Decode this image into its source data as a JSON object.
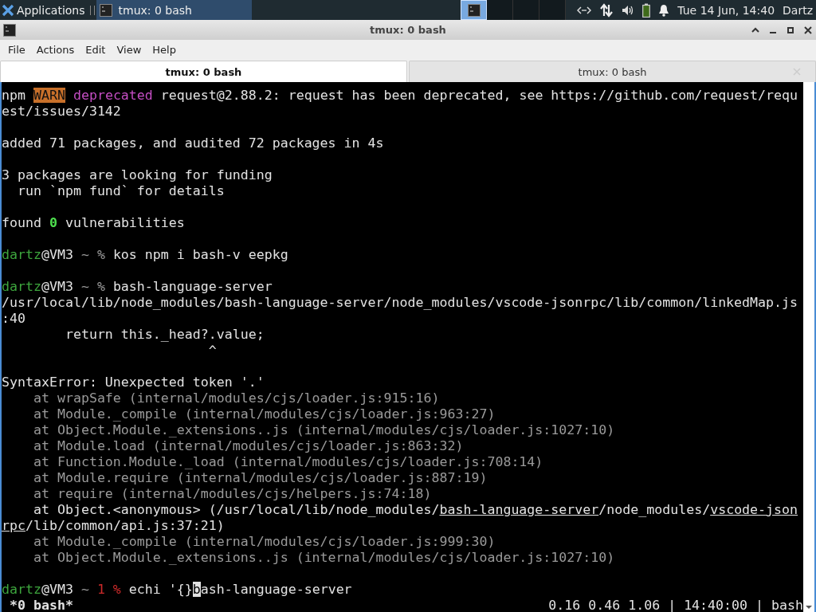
{
  "taskbar": {
    "applications_label": "Applications",
    "tasks": [
      {
        "label": "tmux: 0 bash",
        "selected": true
      }
    ],
    "workspaces": [
      {
        "selected": true
      },
      {
        "selected": false
      },
      {
        "selected": false
      },
      {
        "selected": false
      }
    ],
    "clock": "Tue 14 Jun, 14:40",
    "user": "Dartz"
  },
  "window": {
    "title": "tmux: 0 bash",
    "menu": [
      "File",
      "Actions",
      "Edit",
      "View",
      "Help"
    ],
    "tabs": [
      {
        "label": "tmux: 0 bash",
        "selected": true
      },
      {
        "label": "tmux: 0 bash",
        "selected": false
      }
    ],
    "terminal": {
      "lines": [
        {
          "kind": "text",
          "segments": [
            {
              "kind": "plain",
              "text": "npm "
            },
            {
              "kind": "warn",
              "text": "WARN"
            },
            {
              "kind": "magenta",
              "text": " deprecated"
            },
            {
              "kind": "plain",
              "text": " request@2.88.2: request has been deprecated, see https://github.com/request/requ"
            }
          ]
        },
        {
          "kind": "text",
          "segments": [
            {
              "kind": "plain",
              "text": "est/issues/3142"
            }
          ]
        },
        {
          "kind": "blank"
        },
        {
          "kind": "text",
          "segments": [
            {
              "kind": "plain",
              "text": "added 71 packages, and audited 72 packages in 4s"
            }
          ]
        },
        {
          "kind": "blank"
        },
        {
          "kind": "text",
          "segments": [
            {
              "kind": "plain",
              "text": "3 packages are looking for funding"
            }
          ]
        },
        {
          "kind": "text",
          "segments": [
            {
              "kind": "plain",
              "text": "  run `npm fund` for details"
            }
          ]
        },
        {
          "kind": "blank"
        },
        {
          "kind": "text",
          "segments": [
            {
              "kind": "plain",
              "text": "found "
            },
            {
              "kind": "green-bold",
              "text": "0"
            },
            {
              "kind": "plain",
              "text": " vulnerabilities"
            }
          ]
        },
        {
          "kind": "blank"
        },
        {
          "kind": "text",
          "segments": [
            {
              "kind": "green",
              "text": "dartz"
            },
            {
              "kind": "plain",
              "text": "@VM3 "
            },
            {
              "kind": "dim",
              "text": "~ %"
            },
            {
              "kind": "plain",
              "text": " kos npm i bash-v eepkg"
            }
          ]
        },
        {
          "kind": "blank"
        },
        {
          "kind": "text",
          "segments": [
            {
              "kind": "green",
              "text": "dartz"
            },
            {
              "kind": "plain",
              "text": "@VM3 "
            },
            {
              "kind": "dim",
              "text": "~ %"
            },
            {
              "kind": "plain",
              "text": " bash-language-server"
            }
          ]
        },
        {
          "kind": "text",
          "segments": [
            {
              "kind": "plain",
              "text": "/usr/local/lib/node_modules/bash-language-server/node_modules/vscode-jsonrpc/lib/common/linkedMap.js"
            }
          ]
        },
        {
          "kind": "text",
          "segments": [
            {
              "kind": "plain",
              "text": ":40"
            }
          ]
        },
        {
          "kind": "text",
          "segments": [
            {
              "kind": "plain",
              "text": "        return this._head?.value;"
            }
          ]
        },
        {
          "kind": "text",
          "segments": [
            {
              "kind": "plain",
              "text": "                          ^"
            }
          ]
        },
        {
          "kind": "blank"
        },
        {
          "kind": "text",
          "segments": [
            {
              "kind": "plain",
              "text": "SyntaxError: Unexpected token '.'"
            }
          ]
        },
        {
          "kind": "text",
          "segments": [
            {
              "kind": "dim",
              "text": "    at wrapSafe (internal/modules/cjs/loader.js:915:16)"
            }
          ]
        },
        {
          "kind": "text",
          "segments": [
            {
              "kind": "dim",
              "text": "    at Module._compile (internal/modules/cjs/loader.js:963:27)"
            }
          ]
        },
        {
          "kind": "text",
          "segments": [
            {
              "kind": "dim",
              "text": "    at Object.Module._extensions..js (internal/modules/cjs/loader.js:1027:10)"
            }
          ]
        },
        {
          "kind": "text",
          "segments": [
            {
              "kind": "dim",
              "text": "    at Module.load (internal/modules/cjs/loader.js:863:32)"
            }
          ]
        },
        {
          "kind": "text",
          "segments": [
            {
              "kind": "dim",
              "text": "    at Function.Module._load (internal/modules/cjs/loader.js:708:14)"
            }
          ]
        },
        {
          "kind": "text",
          "segments": [
            {
              "kind": "dim",
              "text": "    at Module.require (internal/modules/cjs/loader.js:887:19)"
            }
          ]
        },
        {
          "kind": "text",
          "segments": [
            {
              "kind": "dim",
              "text": "    at require (internal/modules/cjs/helpers.js:74:18)"
            }
          ]
        },
        {
          "kind": "text",
          "segments": [
            {
              "kind": "plain",
              "text": "    at Object.<anonymous> (/usr/local/lib/node_modules/"
            },
            {
              "kind": "underline",
              "text": "bash-language-server"
            },
            {
              "kind": "plain",
              "text": "/node_modules/"
            },
            {
              "kind": "underline",
              "text": "vscode-json"
            }
          ]
        },
        {
          "kind": "text",
          "segments": [
            {
              "kind": "underline",
              "text": "rpc"
            },
            {
              "kind": "plain",
              "text": "/lib/common/api.js:37:21)"
            }
          ]
        },
        {
          "kind": "text",
          "segments": [
            {
              "kind": "dim",
              "text": "    at Module._compile (internal/modules/cjs/loader.js:999:30)"
            }
          ]
        },
        {
          "kind": "text",
          "segments": [
            {
              "kind": "dim",
              "text": "    at Object.Module._extensions..js (internal/modules/cjs/loader.js:1027:10)"
            }
          ]
        },
        {
          "kind": "blank"
        },
        {
          "kind": "text",
          "segments": [
            {
              "kind": "green",
              "text": "dartz"
            },
            {
              "kind": "plain",
              "text": "@VM3 "
            },
            {
              "kind": "dim",
              "text": "~ "
            },
            {
              "kind": "red",
              "text": "1 %"
            },
            {
              "kind": "plain",
              "text": " echi '{}"
            },
            {
              "kind": "cursor",
              "text": "b"
            },
            {
              "kind": "plain",
              "text": "ash-language-server"
            }
          ]
        }
      ]
    },
    "status": {
      "left": " *0 bash*",
      "right": "0.16 0.46 1.06 | 14:40:00 | bash"
    }
  }
}
